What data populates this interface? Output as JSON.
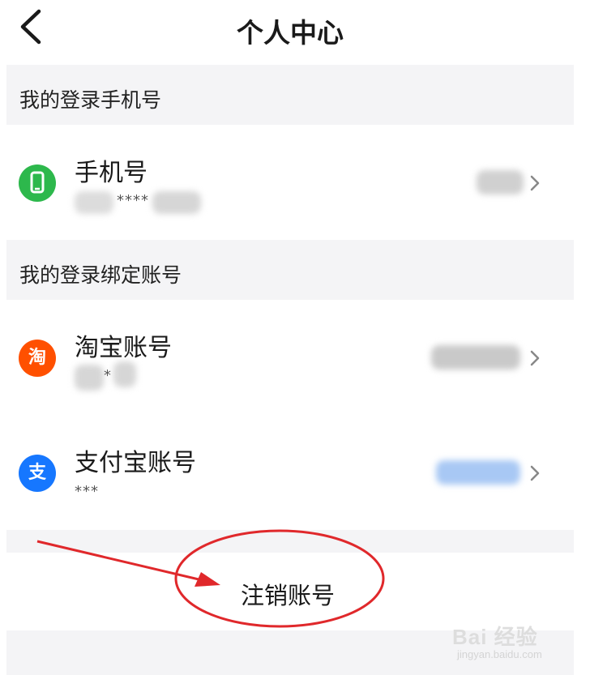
{
  "header": {
    "title": "个人中心",
    "back_icon": "chevron-left-icon"
  },
  "phone_section": {
    "label": "我的登录手机号",
    "item": {
      "title": "手机号",
      "masked": "****",
      "icon": "phone-icon",
      "icon_color": "#2db84c"
    }
  },
  "bound_section": {
    "label": "我的登录绑定账号",
    "taobao": {
      "title": "淘宝账号",
      "masked": "*",
      "icon_glyph": "淘",
      "icon": "taobao-icon",
      "icon_color": "#ff5000"
    },
    "alipay": {
      "title": "支付宝账号",
      "masked": "***",
      "icon_glyph": "支",
      "icon": "alipay-icon",
      "icon_color": "#1677ff"
    }
  },
  "logout": {
    "label": "注销账号"
  },
  "annotation": {
    "color": "#e0282b"
  },
  "watermark": {
    "main": "Bai 经验",
    "sub": "jingyan.baidu.com"
  }
}
